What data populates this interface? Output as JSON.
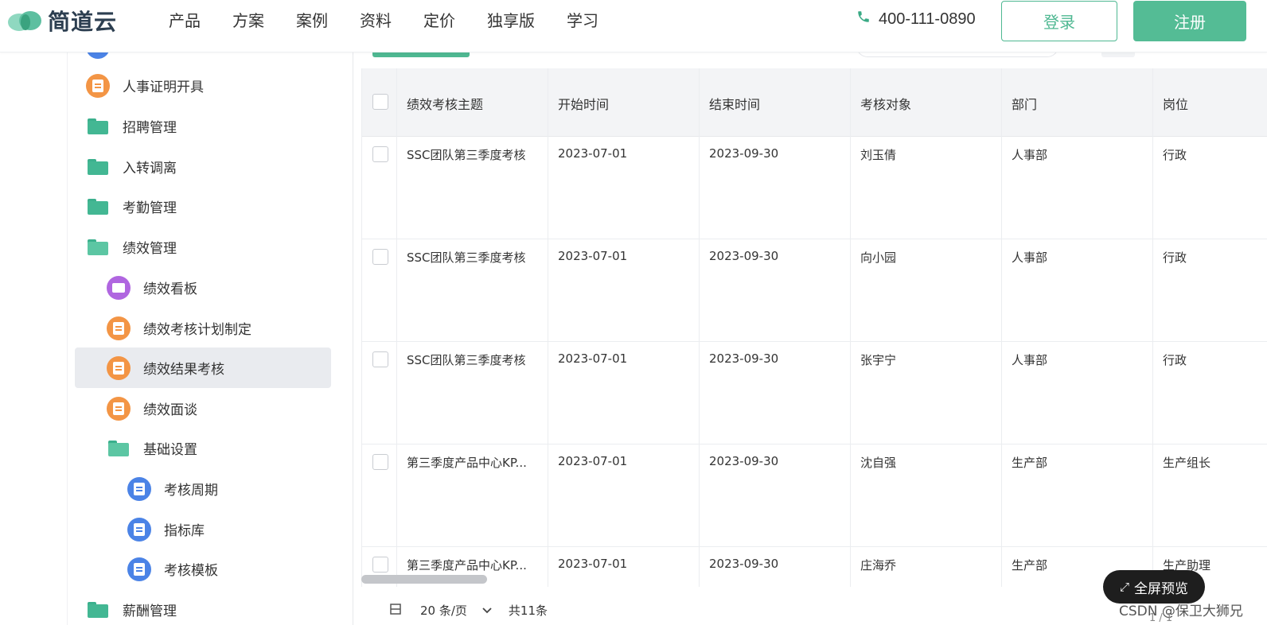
{
  "header": {
    "brand": "简道云",
    "nav": [
      "产品",
      "方案",
      "案例",
      "资料",
      "定价",
      "独享版",
      "学习"
    ],
    "phone": "400-111-0890",
    "login_label": "登录",
    "register_label": "注册",
    "colors": {
      "accent": "#4fb892",
      "register_bg": "#54bc95"
    }
  },
  "sidebar": {
    "items": [
      {
        "label": "人事证明开具",
        "icon": "orange-doc-icon",
        "level": 1
      },
      {
        "label": "招聘管理",
        "icon": "folder-icon",
        "level": 1
      },
      {
        "label": "入转调离",
        "icon": "folder-icon",
        "level": 1
      },
      {
        "label": "考勤管理",
        "icon": "folder-icon",
        "level": 1
      },
      {
        "label": "绩效管理",
        "icon": "folder-open-icon",
        "level": 1
      },
      {
        "label": "绩效看板",
        "icon": "purple-dashboard-icon",
        "level": 2
      },
      {
        "label": "绩效考核计划制定",
        "icon": "orange-form-icon",
        "level": 2
      },
      {
        "label": "绩效结果考核",
        "icon": "orange-form-icon",
        "level": 2,
        "active": true
      },
      {
        "label": "绩效面谈",
        "icon": "orange-form-icon",
        "level": 2
      },
      {
        "label": "基础设置",
        "icon": "folder-open-icon",
        "level": 2
      },
      {
        "label": "考核周期",
        "icon": "blue-doc-icon",
        "level": 3
      },
      {
        "label": "指标库",
        "icon": "blue-doc-icon",
        "level": 3
      },
      {
        "label": "考核模板",
        "icon": "blue-doc-icon",
        "level": 3
      },
      {
        "label": "薪酬管理",
        "icon": "folder-icon",
        "level": 1
      }
    ]
  },
  "table": {
    "columns": [
      "绩效考核主题",
      "开始时间",
      "结束时间",
      "考核对象",
      "部门",
      "岗位"
    ],
    "rows": [
      [
        "SSC团队第三季度考核",
        "2023-07-01",
        "2023-09-30",
        "刘玉倩",
        "人事部",
        "行政"
      ],
      [
        "SSC团队第三季度考核",
        "2023-07-01",
        "2023-09-30",
        "向小园",
        "人事部",
        "行政"
      ],
      [
        "SSC团队第三季度考核",
        "2023-07-01",
        "2023-09-30",
        "张宇宁",
        "人事部",
        "行政"
      ],
      [
        "第三季度产品中心KP...",
        "2023-07-01",
        "2023-09-30",
        "沈自强",
        "生产部",
        "生产组长"
      ],
      [
        "第三季度产品中心KP...",
        "2023-07-01",
        "2023-09-30",
        "庄海乔",
        "生产部",
        "生产助理"
      ]
    ]
  },
  "pagination": {
    "per_page": "20 条/页",
    "total": "共11条",
    "page_indicator": "1 / 1"
  },
  "overlay": {
    "fullscreen_label": "全屏预览",
    "watermark": "CSDN @保卫大狮兄"
  }
}
